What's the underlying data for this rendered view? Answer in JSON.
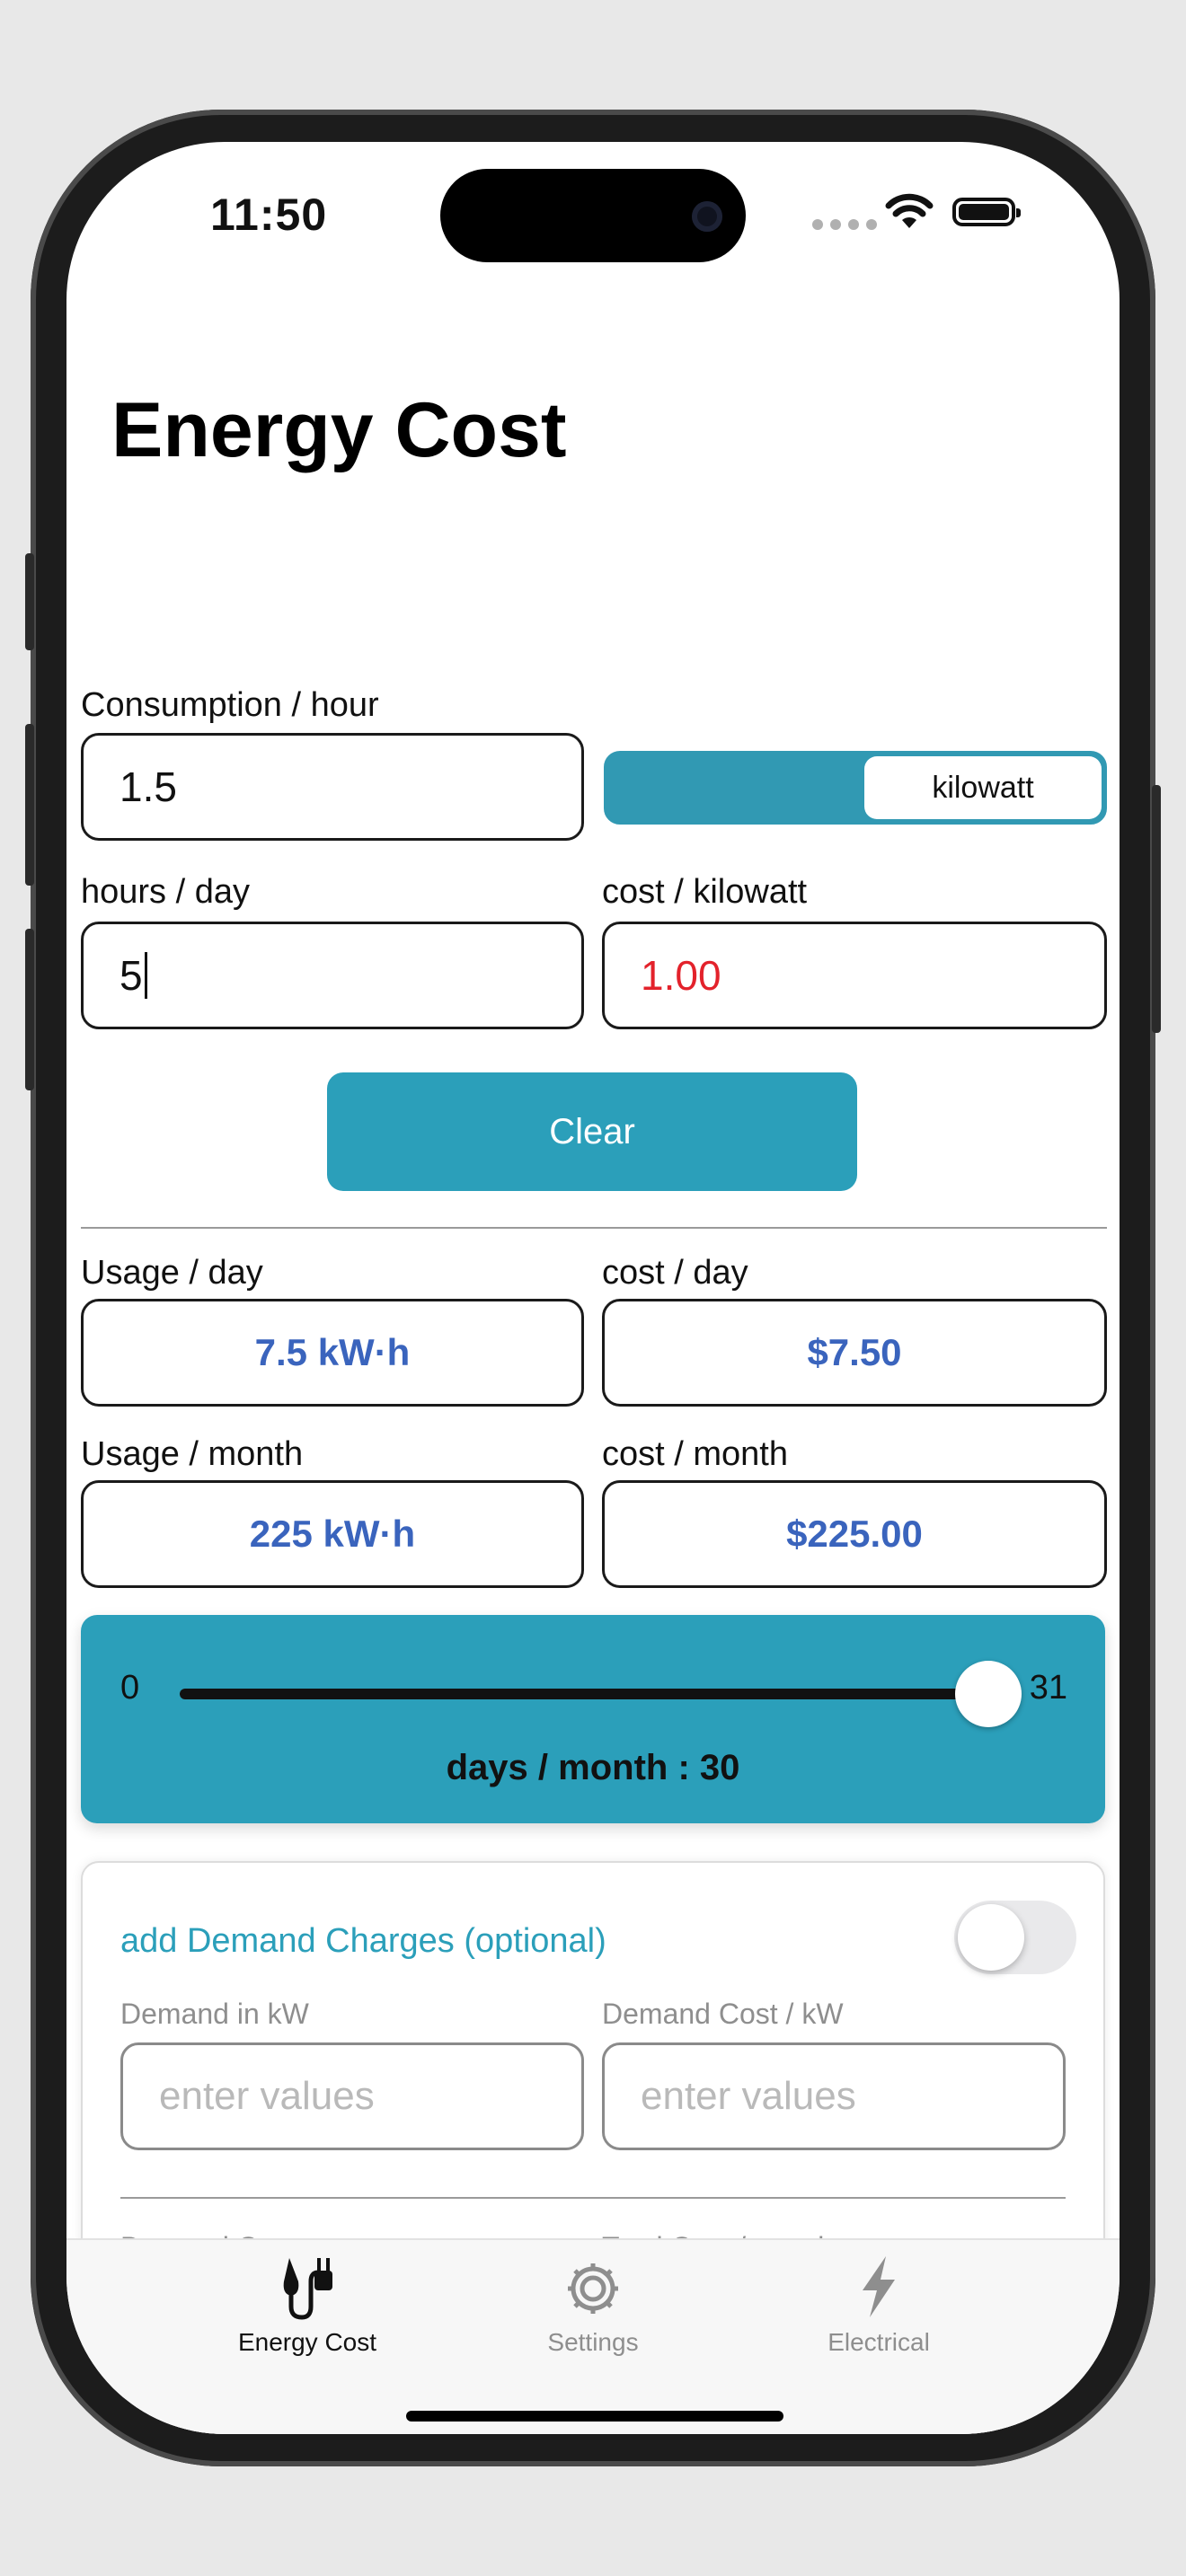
{
  "status_bar": {
    "time": "11:50"
  },
  "page": {
    "title": "Energy Cost"
  },
  "consumption": {
    "label": "Consumption / hour",
    "value": "1.5",
    "unit_selected": "kilowatt"
  },
  "hours": {
    "label": "hours / day",
    "value": "5"
  },
  "cost_per_unit": {
    "label": "cost / kilowatt",
    "value": "1.00"
  },
  "clear_button": {
    "label": "Clear"
  },
  "results": {
    "usage_day": {
      "label": "Usage / day",
      "value": "7.5 kW·h"
    },
    "cost_day": {
      "label": "cost / day",
      "value": "$7.50"
    },
    "usage_month": {
      "label": "Usage / month",
      "value": "225 kW·h"
    },
    "cost_month": {
      "label": "cost / month",
      "value": "$225.00"
    }
  },
  "days_slider": {
    "min_label": "0",
    "max_label": "31",
    "min": 0,
    "max": 31,
    "value": 30,
    "caption": "days / month :  30"
  },
  "demand": {
    "title": "add Demand Charges (optional)",
    "toggle_on": false,
    "demand_kw_label": "Demand in kW",
    "demand_kw_placeholder": "enter values",
    "demand_cost_label": "Demand Cost / kW",
    "demand_cost_placeholder": "enter values",
    "demand_cost_result_label": "Demand Cost",
    "total_cost_label": "Total Cost / month"
  },
  "tabbar": {
    "tabs": [
      {
        "label": "Energy Cost",
        "icon": "plug-icon",
        "active": true
      },
      {
        "label": "Settings",
        "icon": "gear-icon",
        "active": false
      },
      {
        "label": "Electrical",
        "icon": "lightning-icon",
        "active": false
      }
    ]
  },
  "colors": {
    "accent": "#2b9fba",
    "result_text": "#3a64bd",
    "warning_text": "#e3222b"
  }
}
